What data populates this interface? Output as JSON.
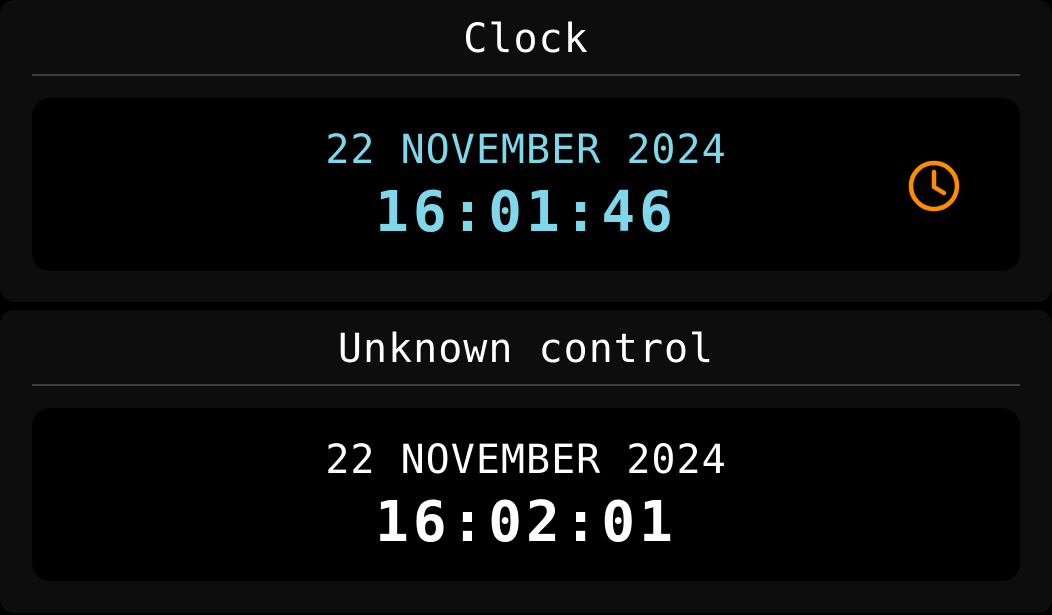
{
  "colors": {
    "accent_cyan": "#7fd8ea",
    "accent_orange": "#ff8c00",
    "panel_bg": "#0d0d0d",
    "display_bg": "#000000",
    "text": "#ffffff"
  },
  "clock_panel": {
    "title": "Clock",
    "date": "22 NOVEMBER 2024",
    "time": "16:01:46",
    "icon": "clock-icon"
  },
  "unknown_panel": {
    "title": "Unknown control",
    "date": "22 NOVEMBER 2024",
    "time": "16:02:01"
  }
}
